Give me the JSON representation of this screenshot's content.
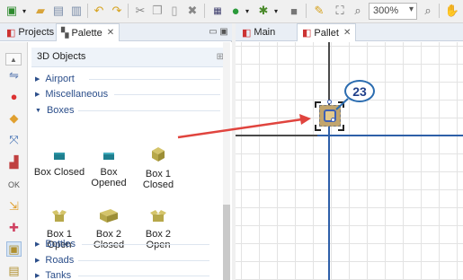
{
  "toolbar": {
    "zoom_value": "300%",
    "icons": [
      "new-icon",
      "dropdown-icon",
      "open-folder-icon",
      "save-icon",
      "save-all-icon",
      "undo-icon",
      "redo-icon",
      "cut-icon",
      "copy-icon",
      "paste-icon",
      "delete-icon",
      "build-icon",
      "run-icon",
      "dropdown-icon",
      "debug-icon",
      "dropdown-icon",
      "stop-icon",
      "pin-icon",
      "zoom-fit-icon",
      "zoom-out-icon",
      "zoom-in-icon",
      "hand-icon"
    ]
  },
  "left_tabs": [
    {
      "label": "Projects",
      "icon": "projects-icon"
    },
    {
      "label": "Palette",
      "icon": "palette-icon"
    }
  ],
  "palette": {
    "header": "3D Objects",
    "sections": {
      "airport": "Airport",
      "miscellaneous": "Miscellaneous",
      "boxes": "Boxes",
      "bottles": "Bottles",
      "roads": "Roads",
      "tanks": "Tanks"
    },
    "objects": [
      {
        "line1": "Box Closed",
        "line2": ""
      },
      {
        "line1": "Box",
        "line2": "Opened"
      },
      {
        "line1": "Box 1",
        "line2": "Closed"
      },
      {
        "line1": "Box 1",
        "line2": "Open"
      },
      {
        "line1": "Box 2",
        "line2": "Closed"
      },
      {
        "line1": "Box 2",
        "line2": "Open"
      }
    ]
  },
  "editor_tabs": [
    {
      "label": "Main",
      "icon": "agent-icon"
    },
    {
      "label": "Pallet",
      "icon": "agent-icon"
    }
  ],
  "canvas": {
    "callout_number": "23"
  },
  "colors": {
    "axis_blue": "#2e5fa8",
    "axis_dark": "#4a4a4a",
    "arrow_red": "#e0443e",
    "box_teal": "#1f7f8f",
    "box_khaki": "#b7a84a"
  }
}
